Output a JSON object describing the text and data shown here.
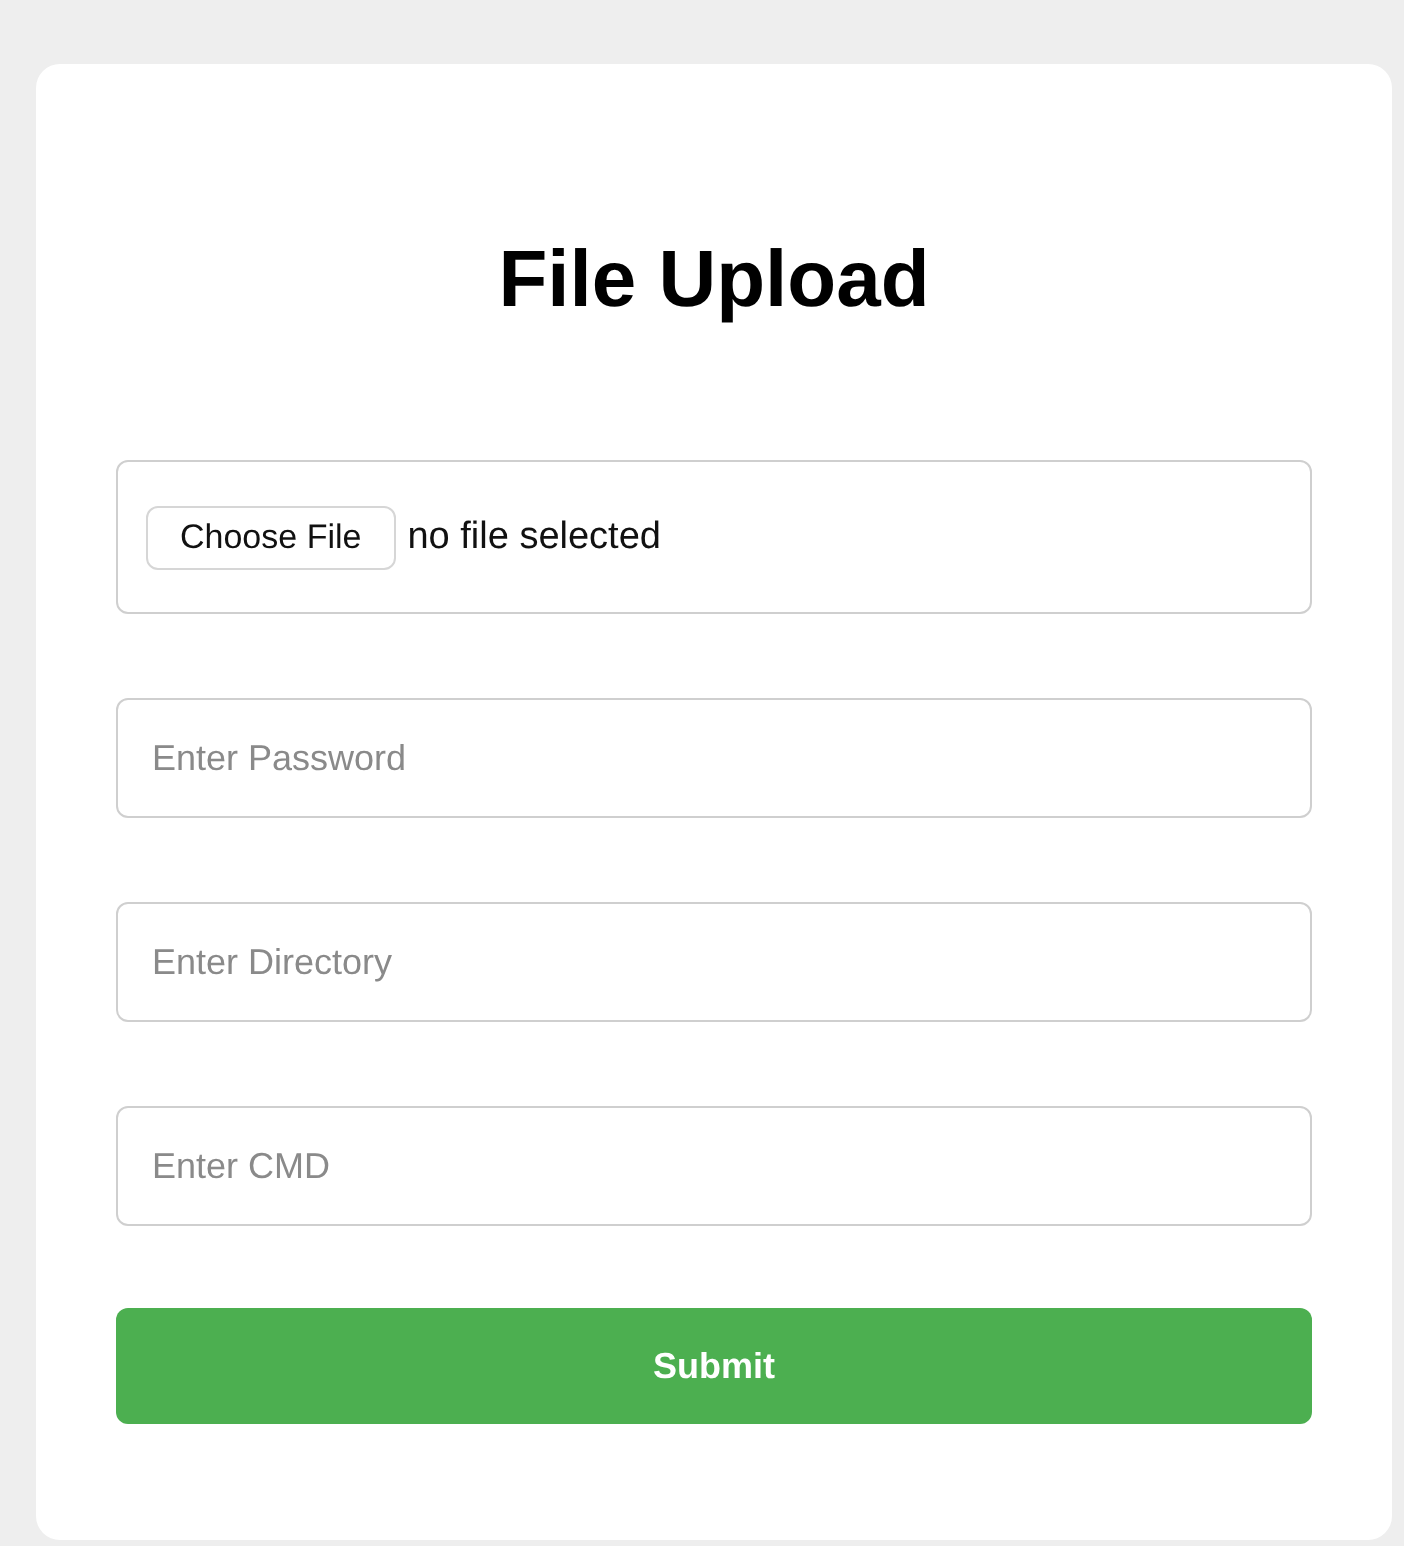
{
  "title": "File Upload",
  "file_field": {
    "button": "Choose File",
    "status": "no file selected"
  },
  "fields": [
    {
      "placeholder": "Enter Password"
    },
    {
      "placeholder": "Enter Directory"
    },
    {
      "placeholder": "Enter CMD"
    }
  ],
  "submit": "Submit"
}
